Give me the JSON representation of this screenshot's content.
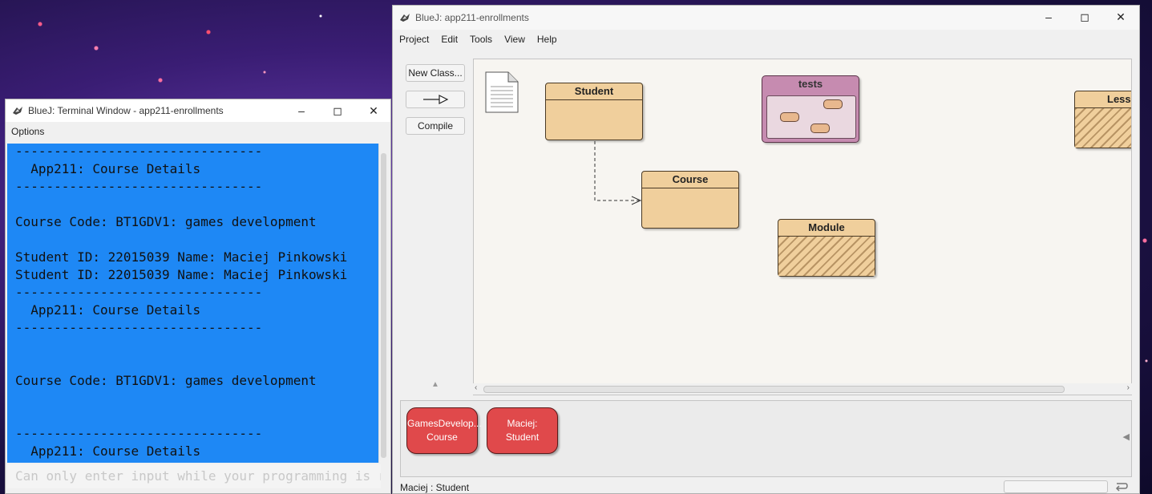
{
  "terminal": {
    "title": "BlueJ: Terminal Window - app211-enrollments",
    "menu": [
      "Options"
    ],
    "lines": [
      "--------------------------------",
      "  App211: Course Details",
      "--------------------------------",
      "",
      "Course Code: BT1GDV1: games development",
      "",
      "Student ID: 22015039 Name: Maciej Pinkowski",
      "Student ID: 22015039 Name: Maciej Pinkowski",
      "--------------------------------",
      "  App211: Course Details",
      "--------------------------------",
      "",
      "",
      "Course Code: BT1GDV1: games development",
      "",
      "",
      "--------------------------------",
      "  App211: Course Details",
      "--------------------------------"
    ],
    "input_placeholder": "Can only enter input while your programming is r"
  },
  "main": {
    "title": "BlueJ:  app211-enrollments",
    "menu": [
      "Project",
      "Edit",
      "Tools",
      "View",
      "Help"
    ],
    "buttons": {
      "new_class": "New Class...",
      "compile": "Compile"
    },
    "classes": {
      "student": "Student",
      "course": "Course",
      "module": "Module",
      "lesson": "Lesso",
      "tests_package": "tests"
    },
    "objects": [
      {
        "line1": "GamesDevelop...",
        "line2": "Course"
      },
      {
        "line1": "Maciej:",
        "line2": "Student"
      }
    ],
    "status": "Maciej : Student"
  },
  "colors": {
    "terminal_bg": "#1e88f5",
    "class_fill": "#f0cf9c",
    "package_fill": "#c68bb0",
    "object_fill": "#e0494b"
  }
}
